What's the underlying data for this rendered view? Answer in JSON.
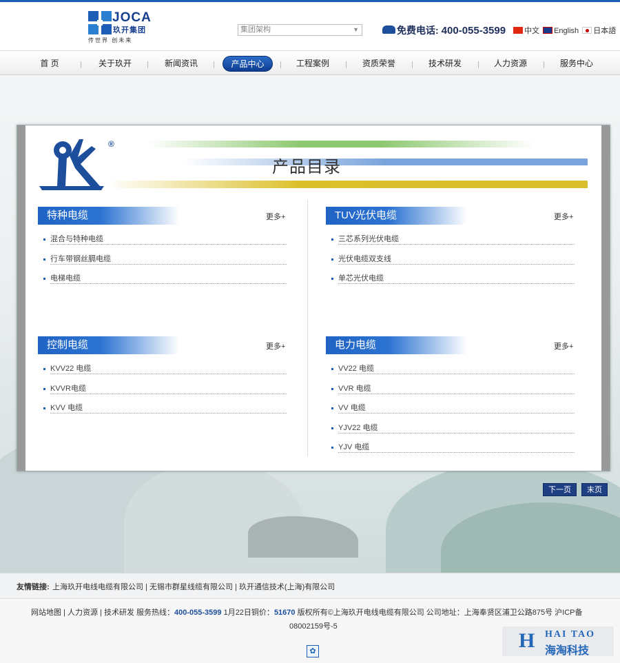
{
  "header": {
    "logo_en": "JOCA",
    "logo_cn": "玖开集团",
    "logo_slogan": "传世界 创未来",
    "group_select": {
      "value": "集团架构"
    },
    "hotline_label": "免费电话:",
    "hotline_number": "400-055-3599",
    "languages": [
      {
        "label": "中文",
        "flag": "cn"
      },
      {
        "label": "English",
        "flag": "uk"
      },
      {
        "label": "日本語",
        "flag": "jp"
      }
    ]
  },
  "nav": {
    "items": [
      {
        "label": "首 页"
      },
      {
        "label": "关于玖开"
      },
      {
        "label": "新闻资讯"
      },
      {
        "label": "产品中心",
        "active": true
      },
      {
        "label": "工程案例"
      },
      {
        "label": "资质荣誉"
      },
      {
        "label": "技术研发"
      },
      {
        "label": "人力资源"
      },
      {
        "label": "服务中心"
      }
    ]
  },
  "catalog": {
    "title": "产品目录",
    "registered_mark": "®",
    "more_label": "更多+",
    "categories": [
      {
        "name": "特种电缆",
        "items": [
          "混合与特种电缆",
          "行车带钢丝膈电缆",
          "电梯电缆"
        ]
      },
      {
        "name": "TUV光伏电缆",
        "items": [
          "三芯系列光伏电缆",
          "光伏电缆双支线",
          "单芯光伏电缆"
        ]
      },
      {
        "name": "控制电缆",
        "items": [
          "KVV22 电缆",
          "KVVR电缆",
          "KVV 电缆"
        ]
      },
      {
        "name": "电力电缆",
        "items": [
          "VV22 电缆",
          "VVR 电缆",
          "VV 电缆",
          "YJV22 电缆",
          "YJV 电缆"
        ]
      }
    ]
  },
  "pager": {
    "next": "下一页",
    "last": "末页"
  },
  "friend_links": {
    "label": "友情链接:",
    "text": "上海玖开电线电缆有限公司 | 无锡市群星线缆有限公司 | 玖开通信技术(上海)有限公司"
  },
  "footer": {
    "line1_prefix": "网站地图 | 人力资源 | 技术研发   服务热线：",
    "hotline": "400-055-3599",
    "line1_mid": "  1月22日铜价：",
    "copper_price": "51670",
    "line1_suffix": " 版权所有©上海玖开电线电缆有限公司    公司地址：上海奉贤区浦卫公路875号  沪ICP备",
    "line2": "08002159号-5",
    "badge": {
      "en": "HAI TAO",
      "cn": "海淘科技"
    }
  },
  "colors": {
    "brand_blue": "#1a5fb4",
    "nav_active": "#1d4e9c",
    "pager_bg": "#1e3f82"
  }
}
